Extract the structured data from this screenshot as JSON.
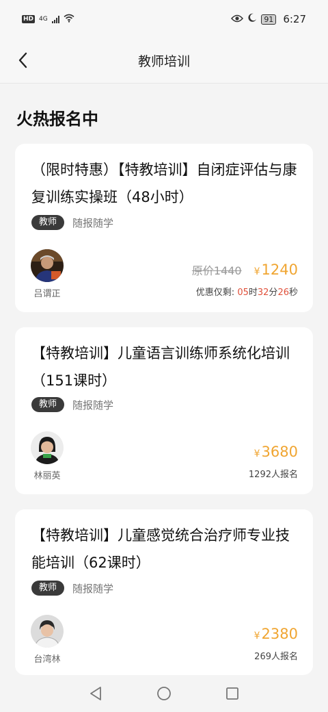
{
  "status_bar": {
    "hd": "HD",
    "signal": "4G",
    "battery": "91",
    "time": "6:27"
  },
  "header": {
    "title": "教师培训"
  },
  "section": {
    "title": "火热报名中"
  },
  "courses": [
    {
      "title": "（限时特惠）【特教培训】自闭症评估与康复训练实操班（48小时）",
      "tag": "教师",
      "tag_text": "随报随学",
      "teacher": "吕谓正",
      "original_price": "原价1440",
      "currency": "¥",
      "price": "1240",
      "countdown": {
        "prefix": "优惠仅剩: ",
        "hours": "05",
        "hours_unit": "时",
        "minutes": "32",
        "minutes_unit": "分",
        "seconds": "26",
        "seconds_unit": "秒"
      }
    },
    {
      "title": "【特教培训】儿童语言训练师系统化培训（151课时）",
      "tag": "教师",
      "tag_text": "随报随学",
      "teacher": "林丽英",
      "currency": "¥",
      "price": "3680",
      "enrolled": "1292人报名"
    },
    {
      "title": "【特教培训】儿童感觉统合治疗师专业技能培训（62课时）",
      "tag": "教师",
      "tag_text": "随报随学",
      "teacher": "台湾林",
      "currency": "¥",
      "price": "2380",
      "enrolled": "269人报名"
    }
  ],
  "icons": {
    "back": "chevron-left-icon",
    "nav_back": "triangle-back-icon",
    "nav_home": "circle-home-icon",
    "nav_recent": "square-recent-icon"
  },
  "colors": {
    "accent_price": "#f0a531",
    "countdown": "#e0503a",
    "tag_bg": "#3a3a3a"
  }
}
